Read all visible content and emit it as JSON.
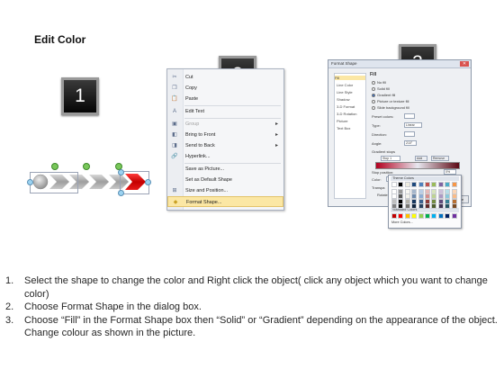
{
  "page": {
    "title": "Edit Color",
    "steps": [
      "1",
      "2",
      "3"
    ]
  },
  "context_menu": {
    "items": [
      {
        "label": "Cut",
        "icon": "scissors-icon",
        "glyph": "✂",
        "disabled": false,
        "submenu": false
      },
      {
        "label": "Copy",
        "icon": "copy-icon",
        "glyph": "❐",
        "disabled": false,
        "submenu": false
      },
      {
        "label": "Paste",
        "icon": "paste-icon",
        "glyph": "📋",
        "disabled": false,
        "submenu": false
      },
      {
        "label": "Edit Text",
        "icon": "edit-text-icon",
        "glyph": "A",
        "disabled": false,
        "submenu": false
      },
      {
        "label": "Group",
        "icon": "group-icon",
        "glyph": "▣",
        "disabled": true,
        "submenu": true
      },
      {
        "label": "Bring to Front",
        "icon": "bring-front-icon",
        "glyph": "◧",
        "disabled": false,
        "submenu": true
      },
      {
        "label": "Send to Back",
        "icon": "send-back-icon",
        "glyph": "◨",
        "disabled": false,
        "submenu": true
      },
      {
        "label": "Hyperlink...",
        "icon": "hyperlink-icon",
        "glyph": "🔗",
        "disabled": false,
        "submenu": false
      },
      {
        "label": "Save as Picture...",
        "icon": "",
        "glyph": "",
        "disabled": false,
        "submenu": false
      },
      {
        "label": "Set as Default Shape",
        "icon": "",
        "glyph": "",
        "disabled": false,
        "submenu": false
      },
      {
        "label": "Size and Position...",
        "icon": "size-position-icon",
        "glyph": "⊞",
        "disabled": false,
        "submenu": false
      },
      {
        "label": "Format Shape...",
        "icon": "format-shape-icon",
        "glyph": "◆",
        "disabled": false,
        "submenu": false,
        "highlighted": true
      }
    ]
  },
  "dialog": {
    "title": "Format Shape",
    "nav": [
      "Fill",
      "Line Color",
      "Line Style",
      "Shadow",
      "3-D Format",
      "3-D Rotation",
      "Picture",
      "Text Box"
    ],
    "fill_heading": "Fill",
    "fill_options": [
      {
        "label": "No fill",
        "selected": false
      },
      {
        "label": "Solid fill",
        "selected": false
      },
      {
        "label": "Gradient fill",
        "selected": true
      },
      {
        "label": "Picture or texture fill",
        "selected": false
      },
      {
        "label": "Slide background fill",
        "selected": false
      }
    ],
    "fields": {
      "preset_label": "Preset colors:",
      "type_label": "Type:",
      "type_value": "Linear",
      "direction_label": "Direction:",
      "angle_label": "Angle:",
      "angle_value": "210°",
      "stops_label": "Gradient stops",
      "stop_value": "Stop 1",
      "add_label": "Add",
      "remove_label": "Remove",
      "stop_position_label": "Stop position:",
      "stop_position_value": "0%",
      "color_label": "Color:",
      "transparency_label": "Transpa",
      "rotate_label": "Rotate"
    },
    "close_label": "Close"
  },
  "color_picker": {
    "theme_header": "Theme Colors",
    "standard_header": "Standard Colors",
    "more_label": "More Colors...",
    "theme_top": [
      "#ffffff",
      "#000000",
      "#eeece1",
      "#1f497d",
      "#4f81bd",
      "#c0504d",
      "#9bbb59",
      "#8064a2",
      "#4bacc6",
      "#f79646"
    ],
    "standard": [
      "#c00000",
      "#ff0000",
      "#ffc000",
      "#ffff00",
      "#92d050",
      "#00b050",
      "#00b0f0",
      "#0070c0",
      "#002060",
      "#7030a0"
    ]
  },
  "instructions": [
    {
      "num": "1.",
      "text": "Select the shape to change the color and Right click the object( click any object which you want to change color)"
    },
    {
      "num": "2.",
      "text": "Choose Format Shape in the dialog box."
    },
    {
      "num": "3.",
      "text": "Choose “Fill” in the Format Shape box then “Solid” or “Gradient” depending on the appearance of the object. Change colour as shown in the picture."
    }
  ]
}
